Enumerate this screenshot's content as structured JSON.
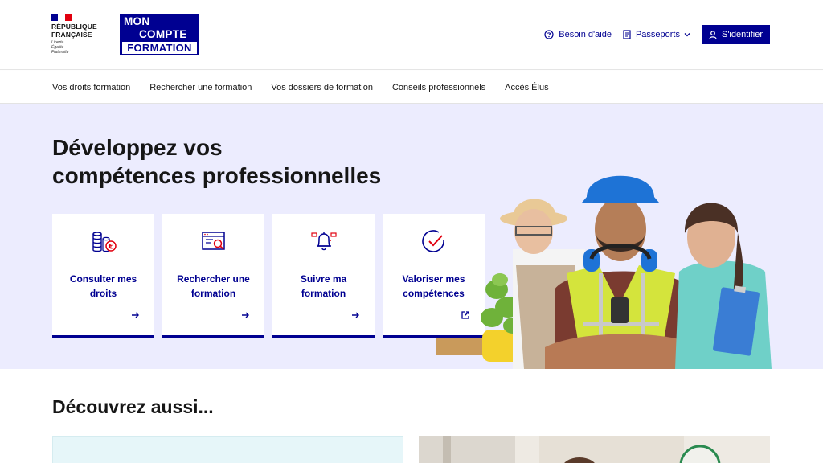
{
  "header": {
    "republic_line1": "RÉPUBLIQUE",
    "republic_line2": "FRANÇAISE",
    "motto": [
      "Liberté",
      "Égalité",
      "Fraternité"
    ],
    "brand_line1": "MON",
    "brand_line2": "COMPTE",
    "brand_line3": "FORMATION",
    "help_label": "Besoin d'aide",
    "passports_label": "Passeports",
    "login_label": "S'identifier"
  },
  "nav": {
    "items": [
      {
        "label": "Vos droits formation"
      },
      {
        "label": "Rechercher une formation"
      },
      {
        "label": "Vos dossiers de formation"
      },
      {
        "label": "Conseils professionnels"
      },
      {
        "label": "Accès Élus"
      }
    ]
  },
  "hero": {
    "title_line1": "Développez vos",
    "title_line2": "compétences professionnelles",
    "cards": [
      {
        "label": "Consulter mes droits",
        "icon": "coins-euro-icon",
        "arrow": "arrow-right-icon"
      },
      {
        "label": "Rechercher une formation",
        "icon": "search-screen-icon",
        "arrow": "arrow-right-icon"
      },
      {
        "label": "Suivre ma formation",
        "icon": "bell-notification-icon",
        "arrow": "arrow-right-icon"
      },
      {
        "label": "Valoriser mes compétences",
        "icon": "check-circle-icon",
        "arrow": "external-link-icon"
      }
    ]
  },
  "discover": {
    "title": "Découvrez aussi..."
  },
  "colors": {
    "primary": "#000091",
    "hero_bg": "#ececfe",
    "accent_red": "#e1000f"
  }
}
